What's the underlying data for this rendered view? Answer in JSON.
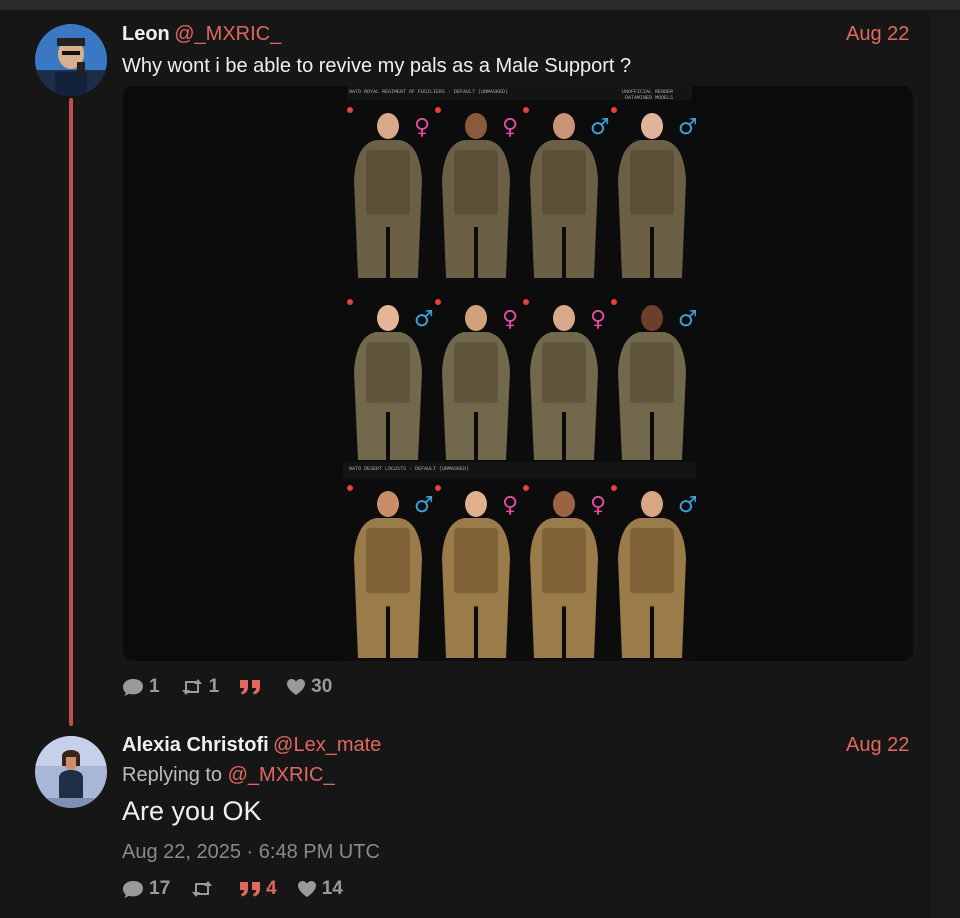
{
  "colors": {
    "accent": "#e0685f",
    "thread_line": "#c0504d",
    "background": "#161616"
  },
  "tweets": [
    {
      "name": "Leon",
      "handle": "@_MXRIC_",
      "date": "Aug 22",
      "text": "Why wont i be able to revive my pals as a Male Support ?",
      "media": {
        "image_description": "Three-panel comparison sheet of soldiers in military uniforms with gender symbols",
        "panel_header_left": "NATO ROYAL REGIMENT OF FUSILIERS · DEFAULT (UNMASKED)",
        "panel_header_right": "UNOFFICIAL RENDER DATAMINED MODELS",
        "panel3_header_left": "NATO DESERT LOCUSTS · DEFAULT (UNMASKED)"
      },
      "stats": {
        "replies": "1",
        "retweets": "1",
        "quotes": "",
        "likes": "30"
      }
    },
    {
      "name": "Alexia Christofi",
      "handle": "@Lex_mate",
      "date": "Aug 22",
      "replying_label": "Replying to",
      "replying_to": "@_MXRIC_",
      "text": "Are you OK",
      "timestamp": "Aug 22, 2025 · 6:48 PM UTC",
      "stats": {
        "replies": "17",
        "retweets": "",
        "quotes": "4",
        "likes": "14"
      }
    }
  ]
}
